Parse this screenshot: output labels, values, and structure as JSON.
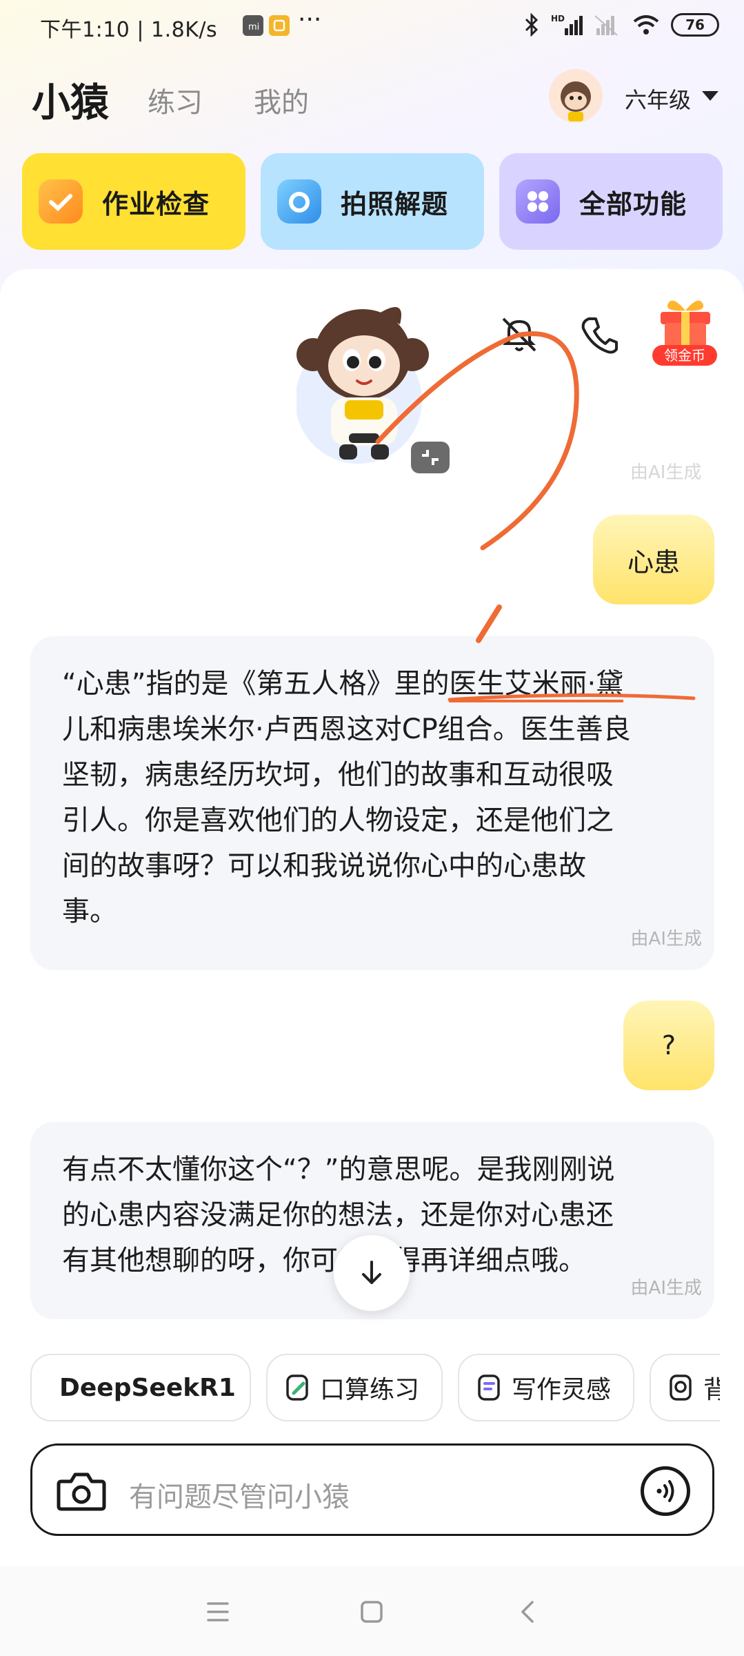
{
  "status_bar": {
    "time": "下午1:10 | 1.8K/s",
    "more": "···",
    "hd_label": "HD",
    "battery": "76"
  },
  "header": {
    "app_name": "小猿",
    "tabs": [
      "练习",
      "我的"
    ],
    "grade": "六年级"
  },
  "quick_actions": [
    {
      "label": "作业检查",
      "icon": "homework-check-icon",
      "color": "#ffe033",
      "icon_color": "#ff9a1f"
    },
    {
      "label": "拍照解题",
      "icon": "camera-solve-icon",
      "color": "#b7e3ff",
      "icon_color": "#3aa0f2"
    },
    {
      "label": "全部功能",
      "icon": "all-features-icon",
      "color": "#d9d4ff",
      "icon_color": "#8c7cf6"
    }
  ],
  "reward": {
    "label": "领金币"
  },
  "ai_tag": "由AI生成",
  "messages": [
    {
      "role": "user",
      "text": "心患"
    },
    {
      "role": "ai",
      "lines": [
        [
          "“心患”指的是《第五人格》里的",
          "医生艾米丽·黛"
        ],
        [
          "儿和病患埃米尔·卢西恩这对CP组合。医生善良"
        ],
        [
          "坚韧，病患经历坎坷，他们的故事和互动很吸"
        ],
        [
          "引人。你是喜欢他们的人物设定，还是他们之"
        ],
        [
          "间的故事呀？可以和我说说你心中的心患故"
        ],
        [
          "事。"
        ]
      ]
    },
    {
      "role": "user",
      "text": "?"
    },
    {
      "role": "ai",
      "lines": [
        [
          "有点不太懂你这个“？”的意思呢。是我刚刚说"
        ],
        [
          "的心患内容没满足你的想法，还是你对心患还"
        ],
        [
          "有其他想聊的呀，你可以说得再详细点哦。"
        ]
      ]
    }
  ],
  "chips": [
    "DeepSeekR1",
    "口算练习",
    "写作灵感",
    "背"
  ],
  "input": {
    "placeholder": "有问题尽管问小猿"
  },
  "colors": {
    "annotation": "#ef6b35",
    "user_bubble": "#ffe36a",
    "ai_bubble": "#f5f6fa"
  }
}
